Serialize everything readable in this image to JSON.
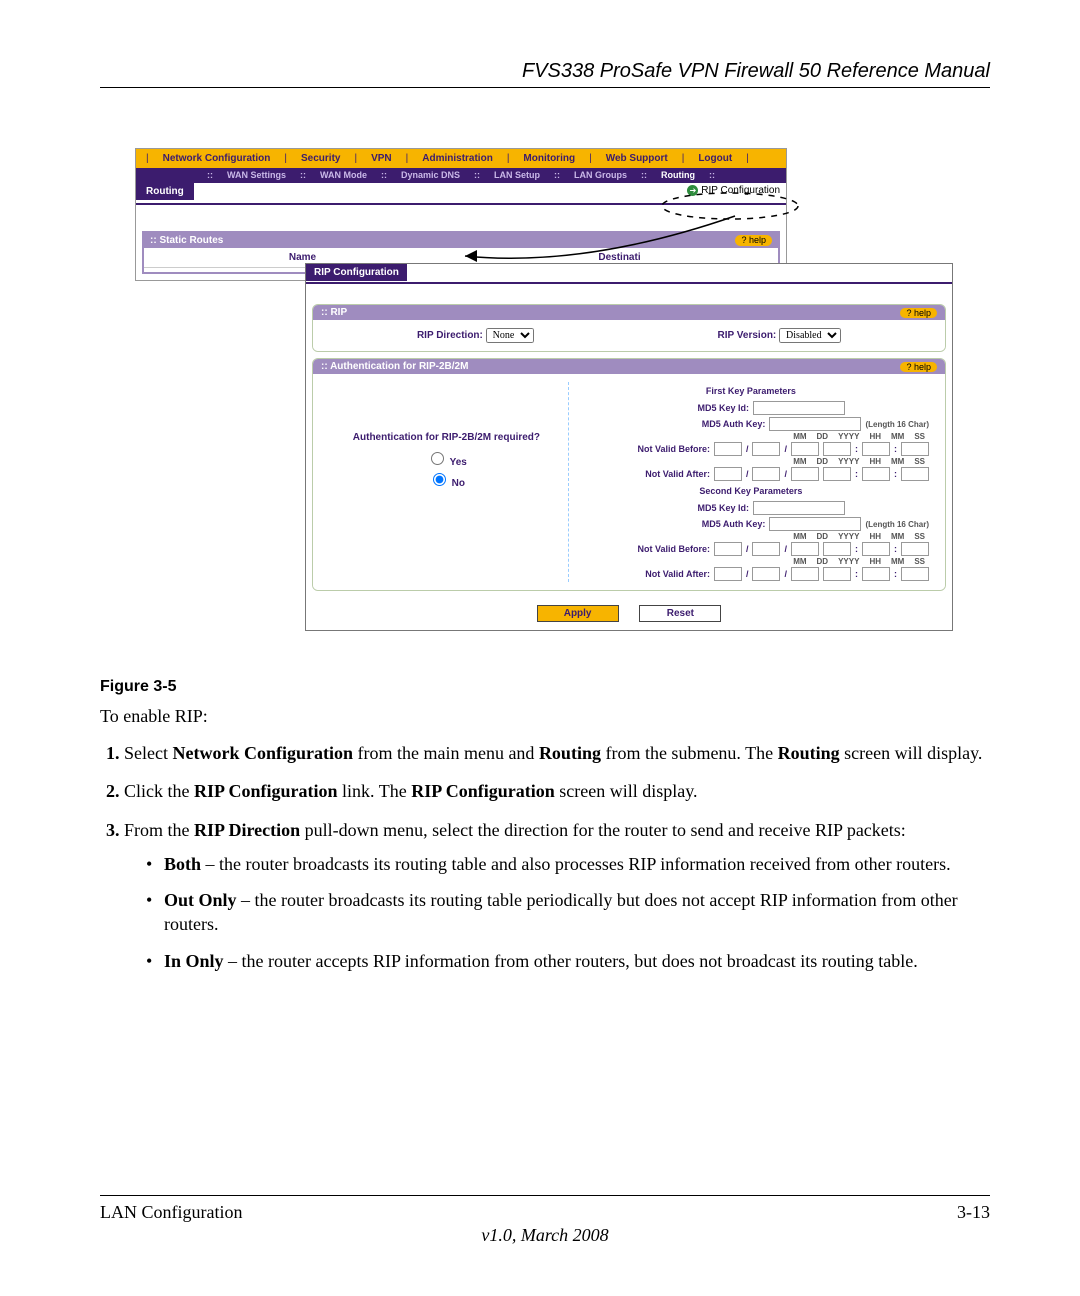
{
  "header": {
    "title": "FVS338 ProSafe VPN Firewall 50 Reference Manual"
  },
  "main_menu": [
    "Network Configuration",
    "Security",
    "VPN",
    "Administration",
    "Monitoring",
    "Web Support",
    "Logout"
  ],
  "sub_menu": [
    "WAN Settings",
    "WAN Mode",
    "Dynamic DNS",
    "LAN Setup",
    "LAN Groups",
    "Routing"
  ],
  "router_tab": "Routing",
  "rip_link": "RIP Configuration",
  "static_routes": {
    "title": "Static Routes",
    "help": "help",
    "cols": [
      "Name",
      "Destinati"
    ]
  },
  "popup": {
    "tab": "RIP Configuration",
    "rip_section": {
      "title": "RIP",
      "help": "help",
      "direction_label": "RIP Direction:",
      "direction_value": "None",
      "version_label": "RIP Version:",
      "version_value": "Disabled"
    },
    "auth_section": {
      "title": "Authentication for RIP-2B/2M",
      "help": "help",
      "question": "Authentication for RIP-2B/2M required?",
      "yes": "Yes",
      "no": "No",
      "kp1_title": "First Key Parameters",
      "kp2_title": "Second Key Parameters",
      "md5_id": "MD5 Key Id:",
      "md5_auth": "MD5 Auth Key:",
      "length_note": "(Length 16 Char)",
      "nvb": "Not Valid Before:",
      "nva": "Not Valid After:",
      "date_hdr": [
        "MM",
        "DD",
        "YYYY",
        "HH",
        "MM",
        "SS"
      ]
    },
    "buttons": {
      "apply": "Apply",
      "reset": "Reset"
    }
  },
  "figure_caption": "Figure 3-5",
  "lead": "To enable RIP:",
  "steps": {
    "s1_a": "Select ",
    "s1_b": "Network Configuration",
    "s1_c": " from the main menu and ",
    "s1_d": "Routing",
    "s1_e": " from the submenu. The ",
    "s1_f": "Routing",
    "s1_g": " screen will display.",
    "s2_a": "Click the ",
    "s2_b": "RIP Configuration",
    "s2_c": " link. The ",
    "s2_d": "RIP Configuration",
    "s2_e": " screen will display.",
    "s3_a": "From the ",
    "s3_b": "RIP Direction",
    "s3_c": " pull-down menu, select the direction for the router to send and receive RIP packets:"
  },
  "bullets": {
    "b1_a": "Both",
    "b1_b": " – the router broadcasts its routing table and also processes RIP information received from other routers.",
    "b2_a": "Out Only",
    "b2_b": " – the router broadcasts its routing table periodically but does not accept RIP information from other routers.",
    "b3_a": "In Only",
    "b3_b": " – the router accepts RIP information from other routers, but does not broadcast its routing table."
  },
  "footer": {
    "section": "LAN Configuration",
    "pagenum": "3-13",
    "version": "v1.0, March 2008"
  }
}
